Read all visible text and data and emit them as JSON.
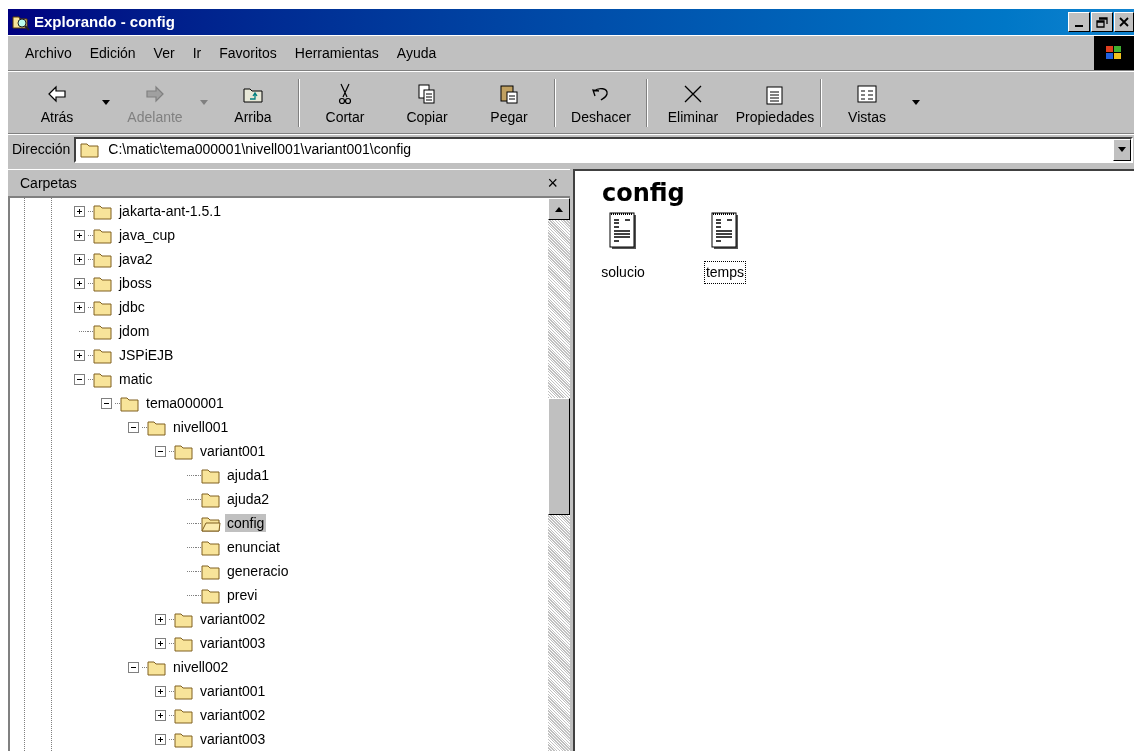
{
  "window": {
    "title": "Explorando - config"
  },
  "menu": [
    "Archivo",
    "Edición",
    "Ver",
    "Ir",
    "Favoritos",
    "Herramientas",
    "Ayuda"
  ],
  "toolbar": [
    {
      "label": "Atrás",
      "disabled": false,
      "dropdown": true,
      "separator_after": false
    },
    {
      "label": "Adelante",
      "disabled": true,
      "dropdown": true,
      "separator_after": false
    },
    {
      "label": "Arriba",
      "disabled": false,
      "dropdown": false,
      "separator_after": true
    },
    {
      "label": "Cortar",
      "disabled": false,
      "dropdown": false,
      "separator_after": false
    },
    {
      "label": "Copiar",
      "disabled": false,
      "dropdown": false,
      "separator_after": false
    },
    {
      "label": "Pegar",
      "disabled": false,
      "dropdown": false,
      "separator_after": true
    },
    {
      "label": "Deshacer",
      "disabled": false,
      "dropdown": false,
      "separator_after": true
    },
    {
      "label": "Eliminar",
      "disabled": false,
      "dropdown": false,
      "separator_after": false
    },
    {
      "label": "Propiedades",
      "disabled": false,
      "dropdown": false,
      "separator_after": true
    },
    {
      "label": "Vistas",
      "disabled": false,
      "dropdown": true,
      "separator_after": false
    }
  ],
  "address": {
    "label": "Dirección",
    "value": "C:\\matic\\tema000001\\nivell001\\variant001\\config"
  },
  "folders_pane": {
    "title": "Carpetas",
    "close": "×",
    "tree": [
      {
        "label": "jakarta-ant-1.5.1",
        "expanded": false,
        "selected": false
      },
      {
        "label": "java_cup",
        "expanded": false,
        "selected": false
      },
      {
        "label": "java2",
        "expanded": false,
        "selected": false
      },
      {
        "label": "jboss",
        "expanded": false,
        "selected": false
      },
      {
        "label": "jdbc",
        "expanded": false,
        "selected": false
      },
      {
        "label": "jdom",
        "selected": false
      },
      {
        "label": "JSPiEJB",
        "expanded": false,
        "selected": false
      },
      {
        "label": "matic",
        "expanded": true,
        "selected": false,
        "children": [
          {
            "label": "tema000001",
            "expanded": true,
            "selected": false,
            "children": [
              {
                "label": "nivell001",
                "expanded": true,
                "selected": false,
                "children": [
                  {
                    "label": "variant001",
                    "expanded": true,
                    "selected": false,
                    "children": [
                      {
                        "label": "ajuda1",
                        "selected": false
                      },
                      {
                        "label": "ajuda2",
                        "selected": false
                      },
                      {
                        "label": "config",
                        "selected": true
                      },
                      {
                        "label": "enunciat",
                        "selected": false
                      },
                      {
                        "label": "generacio",
                        "selected": false
                      },
                      {
                        "label": "previ",
                        "selected": false
                      }
                    ]
                  },
                  {
                    "label": "variant002",
                    "expanded": false,
                    "selected": false
                  },
                  {
                    "label": "variant003",
                    "expanded": false,
                    "selected": false
                  }
                ]
              },
              {
                "label": "nivell002",
                "expanded": true,
                "selected": false,
                "children": [
                  {
                    "label": "variant001",
                    "expanded": false,
                    "selected": false
                  },
                  {
                    "label": "variant002",
                    "expanded": false,
                    "selected": false
                  },
                  {
                    "label": "variant003",
                    "expanded": false,
                    "selected": false
                  }
                ]
              }
            ]
          }
        ]
      }
    ]
  },
  "content": {
    "heading": "config",
    "files": [
      {
        "name": "solucio",
        "focused": false
      },
      {
        "name": "temps",
        "focused": true
      }
    ]
  }
}
